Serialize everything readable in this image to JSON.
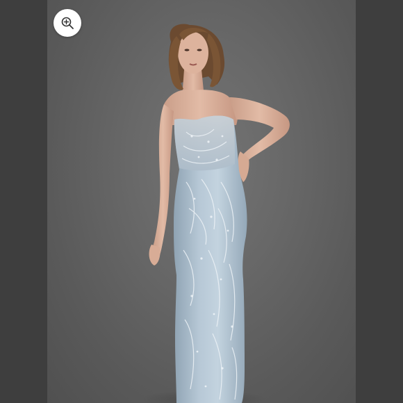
{
  "viewer": {
    "zoom_button_icon": "zoom-in-icon",
    "image_subject": "model-in-gown-photo"
  },
  "colors": {
    "page_background": "#575757",
    "side_panels": "#3e3e3e",
    "gown": "#a9bccb",
    "zoom_button": "#ffffff"
  }
}
